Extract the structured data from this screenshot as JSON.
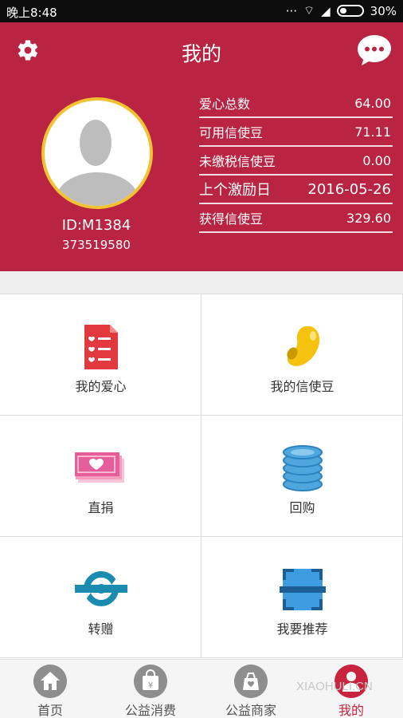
{
  "status_bar": {
    "time": "晚上8:48",
    "battery": "30%"
  },
  "header": {
    "title": "我的"
  },
  "profile": {
    "id": "ID:M1384",
    "phone": "373519580"
  },
  "stats": [
    {
      "label": "爱心总数",
      "value": "64.00"
    },
    {
      "label": "可用信使豆",
      "value": "71.11"
    },
    {
      "label": "未缴税信使豆",
      "value": "0.00"
    },
    {
      "label": "上个激励日",
      "value": "2016-05-26"
    },
    {
      "label": "获得信使豆",
      "value": "329.60"
    }
  ],
  "menu": [
    {
      "label": "我的爱心",
      "icon": "heart-list-icon"
    },
    {
      "label": "我的信使豆",
      "icon": "bean-icon"
    },
    {
      "label": "直捐",
      "icon": "money-heart-icon"
    },
    {
      "label": "回购",
      "icon": "coin-stack-icon"
    },
    {
      "label": "转赠",
      "icon": "transfer-icon"
    },
    {
      "label": "我要推荐",
      "icon": "scan-icon"
    }
  ],
  "tabs": [
    {
      "label": "首页",
      "icon": "home-icon"
    },
    {
      "label": "公益消费",
      "icon": "shopping-bag-icon"
    },
    {
      "label": "公益商家",
      "icon": "merchant-icon"
    },
    {
      "label": "我的",
      "icon": "profile-icon"
    }
  ],
  "watermark": "XIAOHULI.CN",
  "colors": {
    "brand": "#b82441",
    "accent": "#f2c230",
    "active_tab": "#c8243f"
  }
}
